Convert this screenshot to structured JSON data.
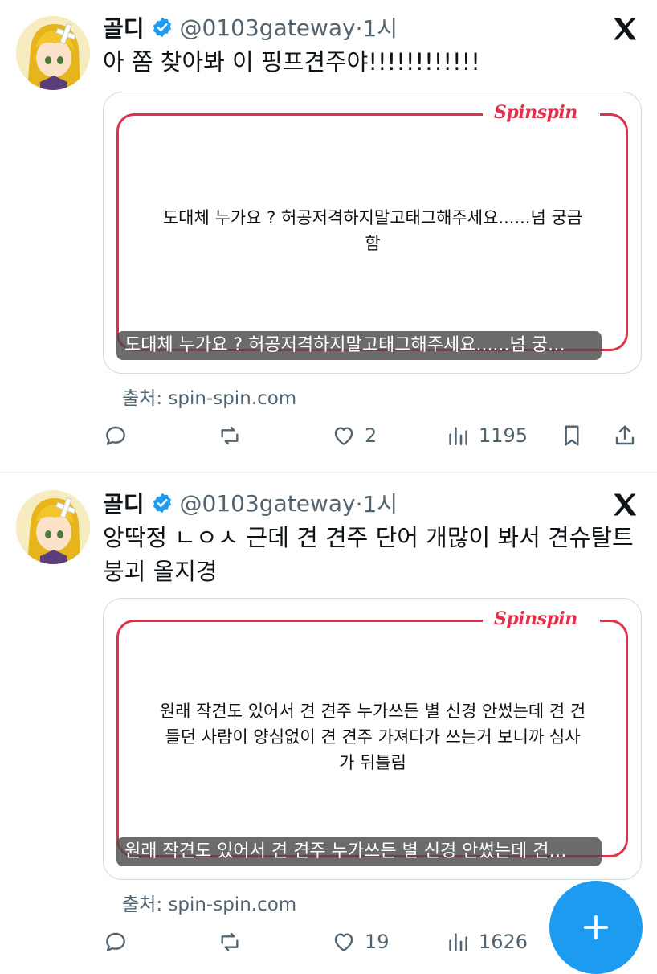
{
  "tweets": [
    {
      "name": "골디",
      "handle": "@0103gateway",
      "time": "·1시",
      "text_lines": [
        "아 쫌 찾아봐 이 핑프견주야!!!!!!!!!!!!"
      ],
      "card": {
        "logo": "Spinspin",
        "body_lines": [
          "도대체 누가요 ? 허공저격하지말고태그해주세요......넘 궁금",
          "함"
        ],
        "caption": "도대체 누가요 ? 허공저격하지말고태그해주세요......넘 궁…"
      },
      "source": "출처: spin-spin.com",
      "actions": {
        "replies": "",
        "retweets": "",
        "likes": "2",
        "views": "1195"
      }
    },
    {
      "name": "골디",
      "handle": "@0103gateway",
      "time": "·1시",
      "text_lines": [
        "앙딱정 ㄴㅇㅅ 근데 견 견주 단어 개많이 봐서 견슈탈트",
        "붕괴 올지경"
      ],
      "card": {
        "logo": "Spinspin",
        "body_lines": [
          "원래 작견도 있어서 견 견주 누가쓰든 별 신경 안썼는데 견 건",
          "들던 사람이 양심없이 견 견주 가져다가 쓰는거 보니까 심사",
          "가 뒤틀림"
        ],
        "caption": "원래 작견도 있어서 견 견주 누가쓰든 별 신경 안썼는데 견…"
      },
      "source": "출처: spin-spin.com",
      "actions": {
        "replies": "",
        "retweets": "",
        "likes": "19",
        "views": "1626"
      }
    }
  ],
  "icons": {
    "verified": "verified-badge-icon",
    "platform": "x-logo-icon",
    "reply": "reply-icon",
    "retweet": "retweet-icon",
    "like": "heart-icon",
    "views": "views-icon",
    "bookmark": "bookmark-icon",
    "share": "share-icon",
    "compose": "plus-icon"
  },
  "colors": {
    "accent": "#1d9bf0",
    "card_brand": "#e0304a",
    "secondary_text": "#536471"
  }
}
